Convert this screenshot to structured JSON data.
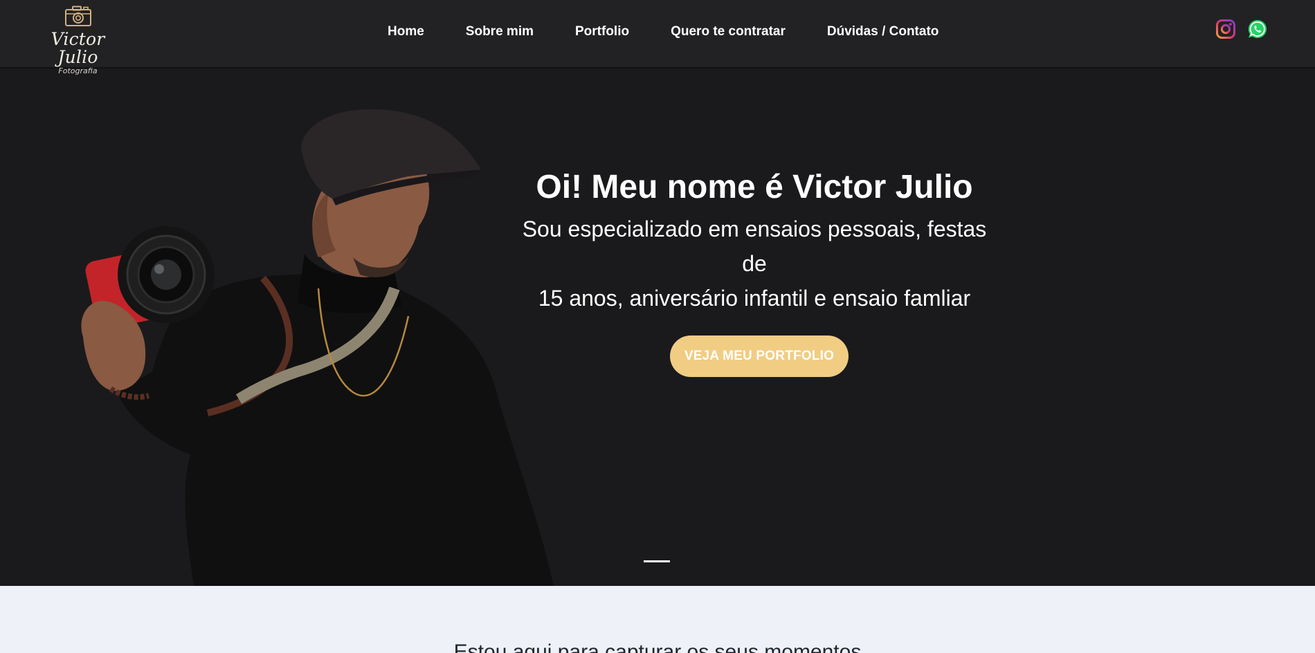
{
  "brand": {
    "name": "Victor Julio",
    "tagline": "Fotografia",
    "icon": "camera-icon",
    "accent_color": "#d2b37a"
  },
  "nav": {
    "items": [
      {
        "label": "Home"
      },
      {
        "label": "Sobre mim"
      },
      {
        "label": "Portfolio"
      },
      {
        "label": "Quero te contratar"
      },
      {
        "label": "Dúvidas / Contato"
      }
    ]
  },
  "social": {
    "icons": [
      "instagram-icon",
      "whatsapp-icon"
    ],
    "whatsapp_color": "#25d366"
  },
  "hero": {
    "title": "Oi! Meu nome é Victor Julio",
    "subtitle_line1": "Sou especializado em ensaios pessoais, festas de",
    "subtitle_line2": "15 anos, aniversário infantil e ensaio famliar",
    "cta_label": "VEJA MEU PORTFOLIO",
    "cta_color": "#f0cd83",
    "background": "#1a1a1c"
  },
  "section": {
    "heading": "Estou aqui para capturar os seus momentos",
    "background": "#eef1f8"
  }
}
